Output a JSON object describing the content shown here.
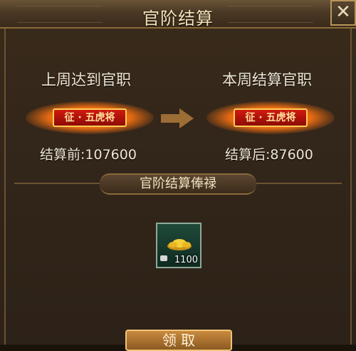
{
  "title": "官阶结算",
  "close_icon_label": "✕",
  "last_week": {
    "label": "上周达到官职",
    "rank": "征 · 五虎将",
    "stat": "结算前:107600"
  },
  "this_week": {
    "label": "本周结算官职",
    "rank": "征 · 五虎将",
    "stat": "结算后:87600"
  },
  "reward_section": {
    "title": "官阶结算俸禄",
    "items": [
      {
        "icon": "gold-ingot-icon",
        "quantity": "1100"
      }
    ]
  },
  "claim_button": {
    "label": "领 取"
  }
}
